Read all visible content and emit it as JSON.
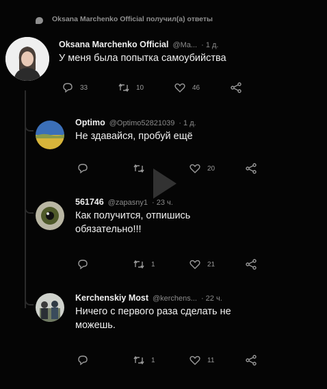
{
  "reply_note": "Oksana Marchenko Official получил(а) ответы",
  "tweets": [
    {
      "name": "Oksana Marchenko Official",
      "handle": "@Ma...",
      "time": "· 1 д.",
      "text": [
        "У меня была попытка самоубийства"
      ],
      "replies": "33",
      "retweets": "10",
      "likes": "46"
    },
    {
      "name": "Optimo",
      "handle": "@Optimo52821039",
      "time": "· 1 д.",
      "text": [
        "Не здавайся, пробуй ещё"
      ],
      "replies": "",
      "retweets": "",
      "likes": "20"
    },
    {
      "name": "561746",
      "handle": "@zapasny1",
      "time": "· 23 ч.",
      "text": [
        "Как получится, отпишись",
        "обязательно!!!"
      ],
      "replies": "",
      "retweets": "1",
      "likes": "21"
    },
    {
      "name": "Kerchenskiy Most",
      "handle": "@kerchens...",
      "time": "· 22 ч.",
      "text": [
        "Ничего с первого раза сделать не",
        "можешь."
      ],
      "replies": "",
      "retweets": "1",
      "likes": "11"
    }
  ],
  "icons": [
    "reply-icon",
    "retweet-icon",
    "like-icon",
    "share-icon",
    "play-icon"
  ],
  "colors": {
    "background": "#050505",
    "muted": "#9a9a9a",
    "text": "#f0f0f0"
  }
}
